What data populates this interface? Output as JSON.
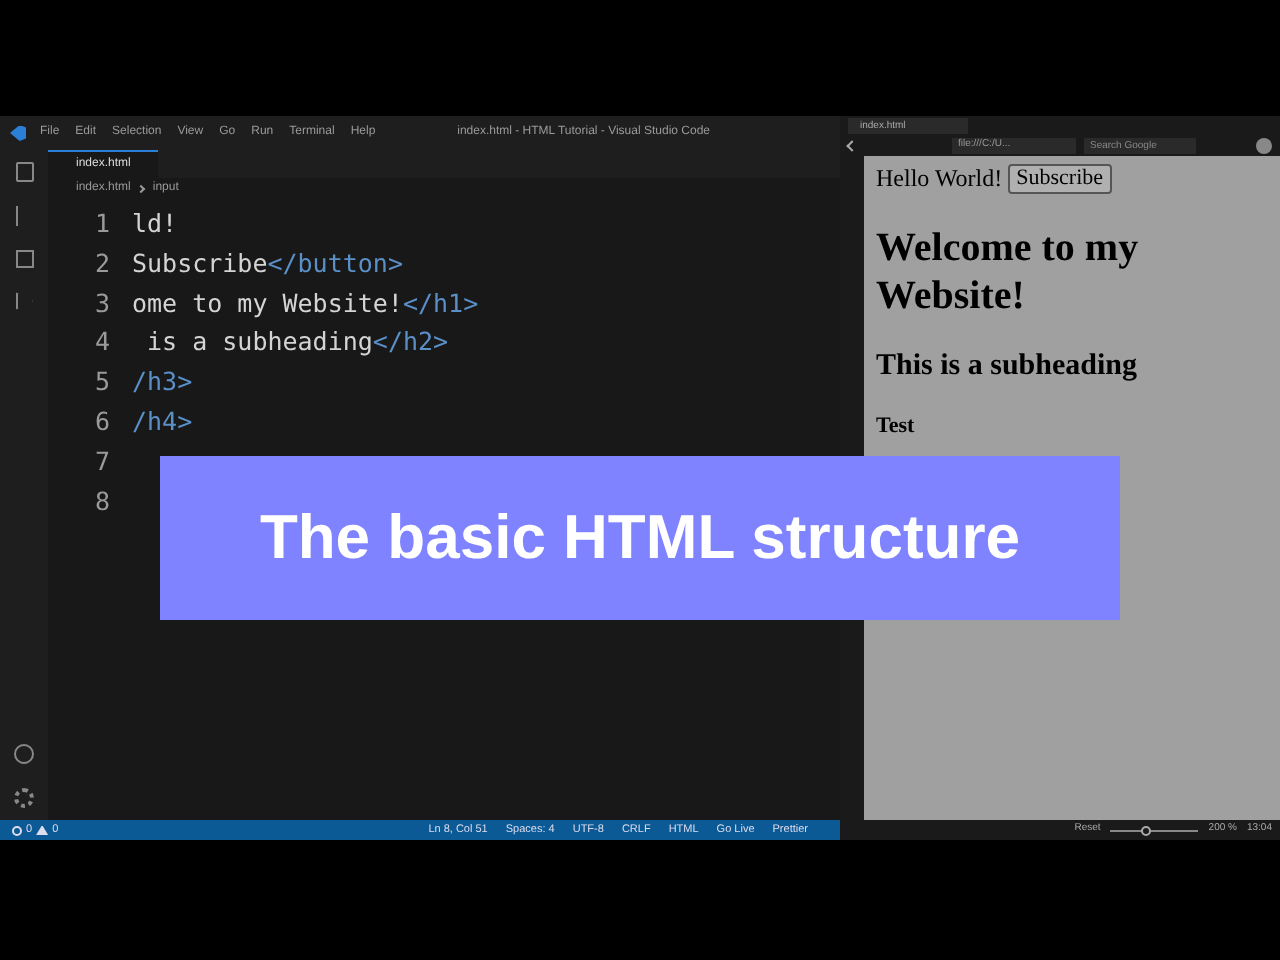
{
  "editor": {
    "menu": [
      "File",
      "Edit",
      "Selection",
      "View",
      "Go",
      "Run",
      "Terminal",
      "Help"
    ],
    "window_title": "index.html - HTML Tutorial - Visual Studio Code",
    "tab": "index.html",
    "breadcrumb": [
      "index.html",
      "input"
    ],
    "lines": [
      {
        "number": "1",
        "text": "ld!"
      },
      {
        "number": "2",
        "text": "Subscribe",
        "tag": "</button>"
      },
      {
        "number": "3",
        "text": "ome to my Website!",
        "tag": "</h1>"
      },
      {
        "number": "4",
        "text": " is a subheading",
        "tag": "</h2>"
      },
      {
        "number": "5",
        "tag": "/h3>"
      },
      {
        "number": "6",
        "tag": "/h4>"
      },
      {
        "number": "7"
      },
      {
        "number": "8"
      }
    ],
    "status_bar": {
      "errors": "0",
      "warnings": "0",
      "items": [
        "Ln 8, Col 51",
        "Spaces: 4",
        "UTF-8",
        "CRLF",
        "HTML",
        "Go Live",
        "Prettier"
      ]
    }
  },
  "browser": {
    "tab": "index.html",
    "address": "file:///C:/U...",
    "search": {
      "placeholder": "Search Google"
    },
    "page": {
      "text": "Hello World!",
      "button": "Subscribe",
      "h1": "Welcome to my Website!",
      "h2": "This is a subheading",
      "h3": "Test"
    },
    "status": {
      "reset": "Reset",
      "zoom": {
        "level": 0.4
      },
      "zoom_reading": "200 %",
      "time": "13:04"
    }
  },
  "overlay": {
    "title": "The basic HTML structure"
  }
}
